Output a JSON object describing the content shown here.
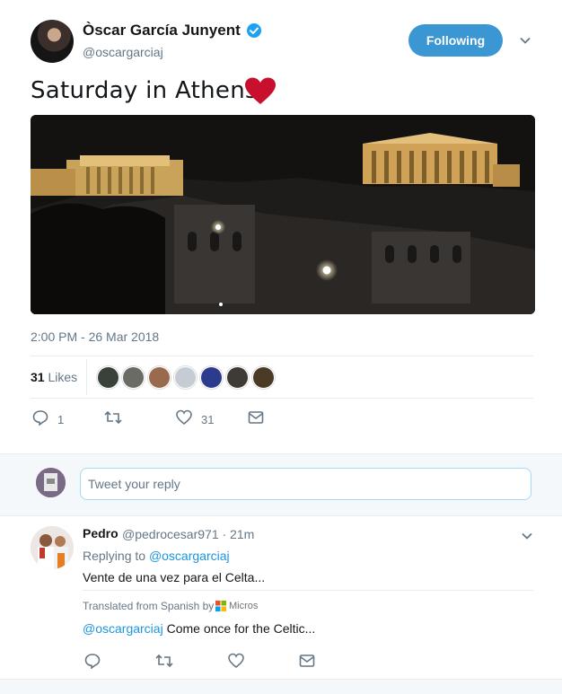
{
  "tweet": {
    "author_name": "Òscar García Junyent",
    "handle": "@oscargarciaj",
    "follow_label": "Following",
    "text": "Saturday in Athens",
    "timestamp": "2:00 PM - 26 Mar 2018",
    "likes": {
      "count": "31",
      "label": "Likes"
    },
    "actions": {
      "reply_count": "1",
      "retweet_count": "",
      "like_count": "31"
    }
  },
  "reply_box": {
    "placeholder": "Tweet your reply"
  },
  "reply": {
    "name": "Pedro",
    "meta": "@pedrocesar971 · 21m",
    "replying_label": "Replying to",
    "replying_to": "@oscargarciaj",
    "text": "Vente de una vez para el Celta...",
    "translated_label": "Translated from Spanish by",
    "translator": "Micros",
    "translation_mention": "@oscargarciaj",
    "translation_text": "Come once for the Celtic..."
  },
  "colors": {
    "accent": "#1da1f2",
    "follow_button": "#3a97d4",
    "heart": "#c8102e"
  },
  "icons": [
    "verified-badge-icon",
    "chevron-down-icon",
    "heart-emoji-icon",
    "reply-icon",
    "retweet-icon",
    "like-icon",
    "message-icon",
    "microsoft-logo-icon"
  ]
}
